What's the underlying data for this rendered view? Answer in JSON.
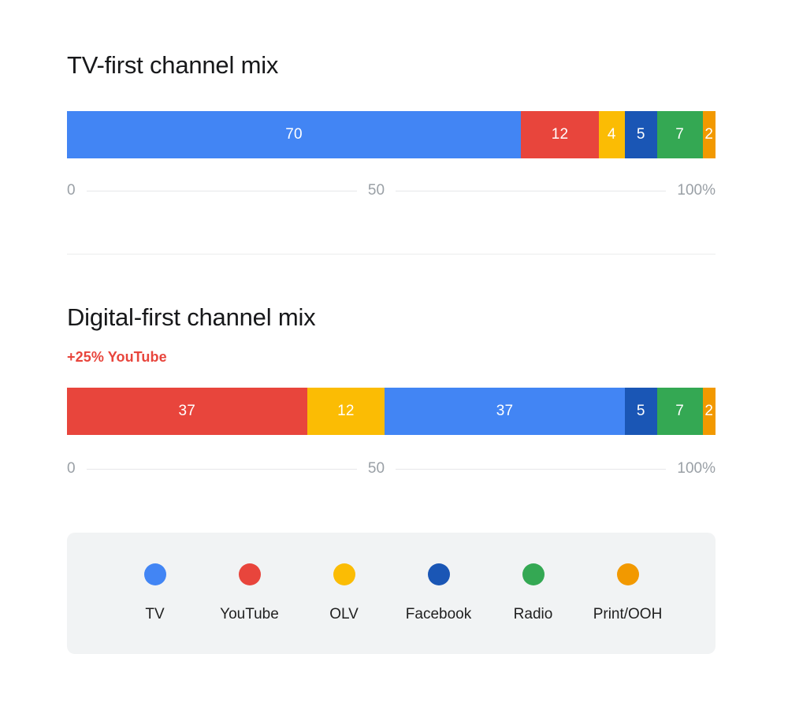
{
  "palette": {
    "tv": "#4285f4",
    "youtube": "#e8453c",
    "olv": "#fbbc04",
    "facebook": "#1a56b5",
    "radio": "#34a853",
    "print_ooh": "#f29900",
    "legend_background": "#f1f3f4",
    "axis_text": "#9aa0a6",
    "title_text": "#17181a",
    "annotation_text": "#e8453c",
    "divider": "#eceded",
    "page_background": "#ffffff"
  },
  "sections": [
    {
      "title": "TV-first channel mix",
      "annotation": "",
      "axis": {
        "start": "0",
        "mid": "50",
        "end": "100%"
      }
    },
    {
      "title": "Digital-first channel mix",
      "annotation": "+25% YouTube",
      "axis": {
        "start": "0",
        "mid": "50",
        "end": "100%"
      }
    }
  ],
  "legend": {
    "items": [
      {
        "label": "TV",
        "color": "#4285f4",
        "icon": "circle-swatch-icon"
      },
      {
        "label": "YouTube",
        "color": "#e8453c",
        "icon": "circle-swatch-icon"
      },
      {
        "label": "OLV",
        "color": "#fbbc04",
        "icon": "circle-swatch-icon"
      },
      {
        "label": "Facebook",
        "color": "#1a56b5",
        "icon": "circle-swatch-icon"
      },
      {
        "label": "Radio",
        "color": "#34a853",
        "icon": "circle-swatch-icon"
      },
      {
        "label": "Print/OOH",
        "color": "#f29900",
        "icon": "circle-swatch-icon"
      }
    ]
  },
  "chart_data": [
    {
      "type": "bar",
      "orientation": "horizontal",
      "stacked": true,
      "title": "TV-first channel mix",
      "subtitle": "",
      "xlabel": "",
      "ylabel": "",
      "xlim": [
        0,
        100
      ],
      "tick_labels": [
        "0",
        "50",
        "100%"
      ],
      "tick_values": [
        0,
        50,
        100
      ],
      "grid": false,
      "legend_position": "bottom",
      "categories": [
        "TV",
        "YouTube",
        "OLV",
        "Facebook",
        "Radio",
        "Print/OOH"
      ],
      "values": [
        70,
        12,
        4,
        5,
        7,
        2
      ],
      "labels": [
        "70",
        "12",
        "4",
        "5",
        "7",
        "2"
      ],
      "colors": [
        "#4285f4",
        "#e8453c",
        "#fbbc04",
        "#1a56b5",
        "#34a853",
        "#f29900"
      ]
    },
    {
      "type": "bar",
      "orientation": "horizontal",
      "stacked": true,
      "title": "Digital-first channel mix",
      "subtitle": "+25% YouTube",
      "xlabel": "",
      "ylabel": "",
      "xlim": [
        0,
        100
      ],
      "tick_labels": [
        "0",
        "50",
        "100%"
      ],
      "tick_values": [
        0,
        50,
        100
      ],
      "grid": false,
      "legend_position": "bottom",
      "categories": [
        "YouTube",
        "OLV",
        "TV",
        "Facebook",
        "Radio",
        "Print/OOH"
      ],
      "values": [
        37,
        12,
        37,
        5,
        7,
        2
      ],
      "labels": [
        "37",
        "12",
        "37",
        "5",
        "7",
        "2"
      ],
      "colors": [
        "#e8453c",
        "#fbbc04",
        "#4285f4",
        "#1a56b5",
        "#34a853",
        "#f29900"
      ]
    }
  ]
}
